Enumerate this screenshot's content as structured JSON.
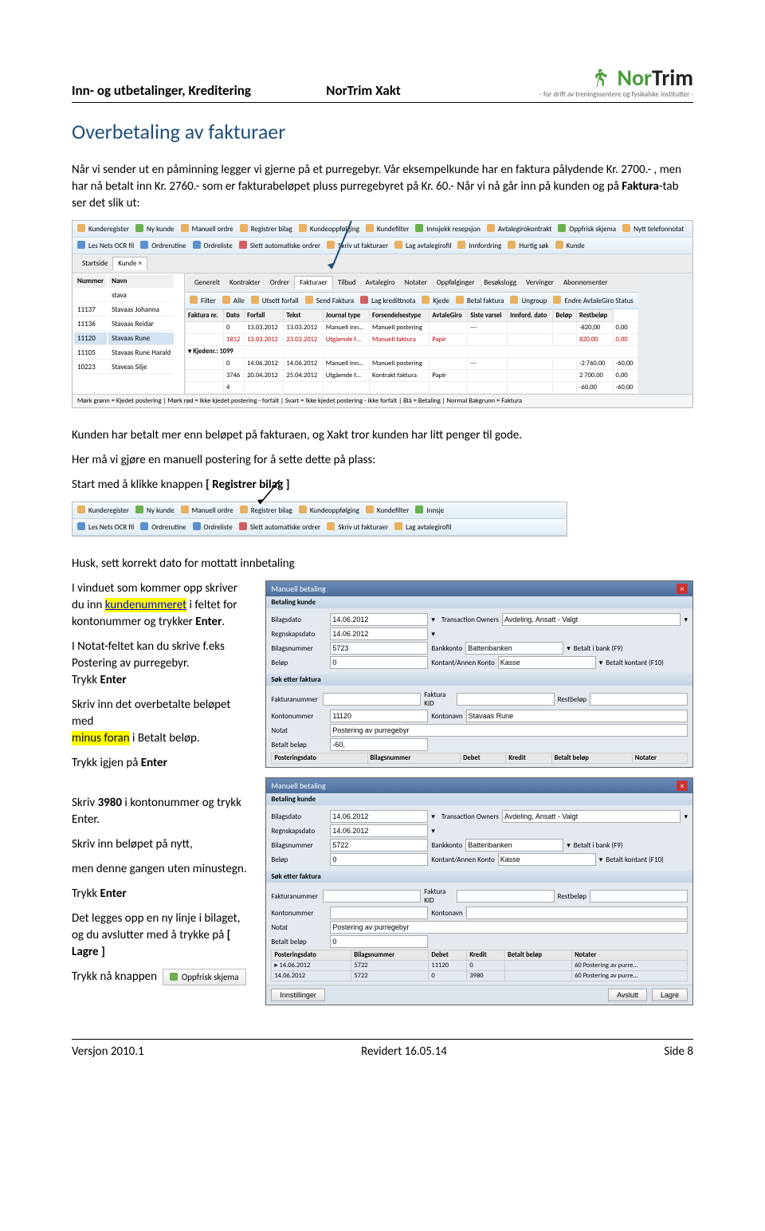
{
  "header": {
    "left": "Inn- og utbetalinger, Kreditering",
    "mid": "NorTrim Xakt",
    "logo_nor": "Nor",
    "logo_trim": "Trim",
    "logo_sub": "- for drift av treningssentere og fysikalske institutter -"
  },
  "title": "Overbetaling av fakturaer",
  "body": {
    "p1": "Når vi sender ut en påminning legger vi gjerne på et purregebyr. Vår eksempelkunde har en faktura pålydende Kr. 2700.- , men har nå betalt inn Kr. 2760.- som er fakturabeløpet pluss purregebyret på Kr. 60.- Når vi nå går inn på kunden og på ",
    "p1_bold": "Faktura",
    "p1_after": "-tab  ser det slik ut:",
    "p2": "Kunden har betalt mer enn beløpet på fakturaen, og Xakt tror kunden har litt penger til gode.",
    "p3": "Her må vi gjøre en manuell postering for å sette dette på plass:",
    "p4_pre": "Start med å klikke knappen ",
    "p4_bold": "[ Registrer bilag ]",
    "p5": "Husk, sett korrekt dato for mottatt innbetaling",
    "p6a": "I vinduet som kommer opp skriver du inn ",
    "p6b": "kundenummeret",
    "p6c": " i feltet for kontonummer og trykker ",
    "p6d": "Enter",
    "p6e": ".",
    "p7a": "I Notat-feltet kan du skrive f.eks Postering av purregebyr.",
    "p7b": "Trykk ",
    "p7c": "Enter",
    "p8a": "Skriv inn det overbetalte beløpet med",
    "p8b": "minus foran",
    "p8c": " i Betalt beløp.",
    "p9a": "Trykk igjen på ",
    "p9b": "Enter",
    "p10a": "Skriv ",
    "p10b": "3980",
    "p10c": " i kontonummer og trykk Enter.",
    "p11": "Skriv inn beløpet på nytt,",
    "p12": "men denne gangen uten minustegn.",
    "p13a": "Trykk ",
    "p13b": "Enter",
    "p14a": "Det legges opp en ny linje i bilaget, og du avslutter med å trykke på  ",
    "p14b": "[ Lagre ]",
    "p15": "Trykk nå knappen",
    "refresh_label": "Oppfrisk skjema"
  },
  "screenshot1": {
    "toolbar1": [
      "Kunderegister",
      "Ny kunde",
      "Manuell ordre",
      "Registrer bilag",
      "Kundeoppfølging",
      "Kundefilter",
      "Innsjekk resepsjon",
      "Avtalegirokontrakt",
      "Oppfrisk skjema",
      "Nytt telefonnotat"
    ],
    "toolbar2": [
      "Les Nets OCR fil",
      "Ordrerutine",
      "Ordreliste",
      "Slett automatiske ordrer",
      "Skriv ut fakturaer",
      "Lag avtalegirofil",
      "Innfordring",
      "Hurtig søk",
      "Kunde"
    ],
    "maintabs": [
      "Startside",
      "Kunde ×"
    ],
    "left_cols": [
      "Nummer",
      "Navn"
    ],
    "left_rows": [
      [
        "",
        "stava"
      ],
      [
        "11137",
        "Stavaas Johanna"
      ],
      [
        "11136",
        "Stavaas Reidar"
      ],
      [
        "11120",
        "Stavaas Rune"
      ],
      [
        "11105",
        "Stavaas Rune Harald"
      ],
      [
        "10223",
        "Staveas Silje"
      ]
    ],
    "subtabs": [
      "Generelt",
      "Kontrakter",
      "Ordrer",
      "Fakturaer",
      "Tilbud",
      "Avtalegiro",
      "Notater",
      "Oppfølginger",
      "Besøkslogg",
      "Vervinger",
      "Abonnementer"
    ],
    "acttoolbar": [
      "Filter",
      "Alle",
      "Utsett forfall",
      "Send Faktura",
      "Lag kredittnota",
      "Kjede",
      "Betal faktura",
      "Ungroup",
      "Endre AvtaleGiro Status"
    ],
    "grid_cols": [
      "Faktura nr.",
      "Dato",
      "Forfall",
      "Tekst",
      "Journal type",
      "Forsendelsestype",
      "AvtaleGiro",
      "Siste varsel",
      "Innford. dato",
      "Beløp",
      "Restbeløp"
    ],
    "grid_rows": [
      [
        "",
        "0",
        "13.03.2012",
        "13.03.2012",
        "Manuell inn…",
        "Manuell postering",
        "",
        "---",
        "",
        "",
        "-820,00",
        "0,00"
      ],
      [
        "",
        "1812",
        "13.03.2012",
        "23.03.2012",
        "Utgående f…",
        "Manuell faktura",
        "Papir",
        "",
        "",
        "",
        "820,00",
        "0,00"
      ],
      [
        "▾",
        "Kjedenr.: 1099",
        "",
        "",
        "",
        "",
        "",
        "",
        "",
        "",
        "",
        ""
      ],
      [
        "",
        "0",
        "14.06.2012",
        "14.06.2012",
        "Manuell inn…",
        "Manuell postering",
        "",
        "---",
        "",
        "",
        "-2 760,00",
        "-60,00"
      ],
      [
        "",
        "3746",
        "20.04.2012",
        "25.04.2012",
        "Utgående f…",
        "Kontrakt faktura",
        "Papir",
        "",
        "",
        "",
        "2 700,00",
        "0,00"
      ],
      [
        "",
        "4",
        "",
        "",
        "",
        "",
        "",
        "",
        "",
        "",
        "-60,00",
        "-60,00"
      ]
    ],
    "legend": "Mørk grønn = Kjedet postering   |   Mørk rød = Ikke kjedet postering - forfalt   |   Svart = Ikke kjedet postering - ikke forfalt   |   Blå = Betaling   |   Normal Bakgrunn = Faktura"
  },
  "screenshot2": {
    "toolbar1": [
      "Kunderegister",
      "Ny kunde",
      "Manuell ordre",
      "Registrer bilag",
      "Kundeoppfølging",
      "Kundefilter",
      "Innsje"
    ],
    "toolbar2": [
      "Les Nets OCR fil",
      "Ordrerutine",
      "Ordreliste",
      "Slett automatiske ordrer",
      "Skriv ut fakturaer",
      "Lag avtalegirofil"
    ]
  },
  "dialog1": {
    "title": "Manuell betaling",
    "sec_bet": "Betaling kunde",
    "bilagsdato_l": "Bilagsdato",
    "bilagsdato": "14.06.2012",
    "trans_l": "Transaction Owners",
    "trans": "Avdeling, Ansatt - Valgt",
    "regn_l": "Regnskapsdato",
    "regn": "14.06.2012",
    "bilagnr_l": "Bilagsnummer",
    "bilagnr": "5723",
    "bankk_l": "Bankkonto",
    "bankk": "Batteribanken",
    "betbank_l": "Betalt i bank (F9)",
    "belop_l": "Beløp",
    "belop": "0",
    "kontant_l": "Kontant/Annen Konto",
    "kontant": "Kasse",
    "betk_l": "Betalt kontant (F10)",
    "sec_sok": "Søk etter faktura",
    "faknum_l": "Fakturanummer",
    "fakkid_l": "Faktura KID",
    "restb_l": "Restbeløp",
    "kontnum_l": "Kontonummer",
    "kontnum": "11120",
    "kontonavn_l": "Kontonavn",
    "kontonavn": "Stavaas Rune",
    "notat_l": "Notat",
    "notat": "Postering av purregebyr",
    "betbel_l": "Betalt beløp",
    "betbel": "-60,",
    "grid_cols": [
      "Posteringsdato",
      "Bilagsnummer",
      "Debet",
      "Kredit",
      "Betalt beløp",
      "Notater"
    ]
  },
  "dialog2": {
    "title": "Manuell betaling",
    "sec_bet": "Betaling kunde",
    "bilagsdato": "14.06.2012",
    "trans": "Avdeling, Ansatt - Valgt",
    "regn": "14.06.2012",
    "bilagnr": "5722",
    "bankk": "Batteribanken",
    "belop": "0",
    "kontant": "Kasse",
    "notat": "Postering av purregebyr",
    "betbel": "0",
    "grid_cols": [
      "Posteringsdato",
      "Bilagsnummer",
      "Debet",
      "Kredit",
      "Betalt beløp",
      "Notater"
    ],
    "grid_rows": [
      [
        "▸ 14.06.2012",
        "5722",
        "11120",
        "0",
        "",
        "60  Postering av purre…"
      ],
      [
        "14.06.2012",
        "5722",
        "0",
        "3980",
        "",
        "60  Postering av purre…"
      ]
    ],
    "btn_inst": "Innstillinger",
    "btn_avs": "Avslutt",
    "btn_lagre": "Lagre"
  },
  "footer": {
    "left": "Versjon 2010.1",
    "mid": "Revidert 16.05.14",
    "right": "Side 8"
  }
}
